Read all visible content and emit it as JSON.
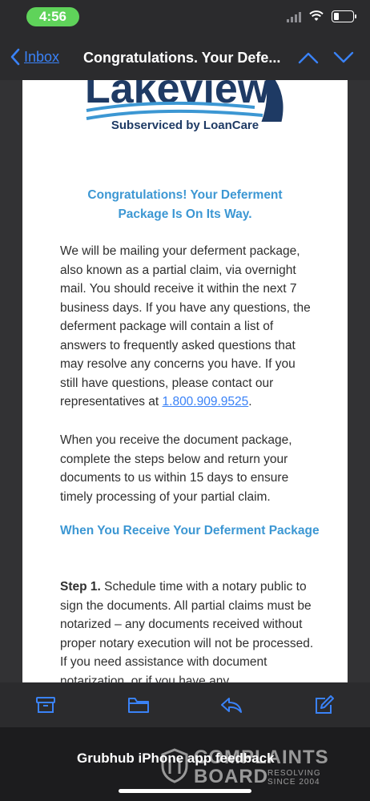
{
  "status_bar": {
    "time": "4:56"
  },
  "nav": {
    "back_label": "Inbox",
    "subject": "Congratulations. Your Defe..."
  },
  "email": {
    "logo_text": "Lakeview",
    "logo_subtitle": "Subserviced by LoanCare",
    "heading_line1": "Congratulations! Your Deferment",
    "heading_line2": "Package Is On Its Way.",
    "para1_text": "We will be mailing your deferment package, also known as a partial claim, via overnight mail. You should receive it within the next 7 business days. If you have any questions, the deferment package will contain a list of answers to frequently asked questions that may resolve any concerns you have. If you still have questions, please contact our representatives at ",
    "phone": "1.800.909.9525",
    "para1_end": ".",
    "para2_text": "When you receive the document package, complete the steps below and return your documents to us within 15 days to ensure timely processing of your partial claim.",
    "subheading": "When You Receive Your Deferment Package",
    "step1_label": "Step 1.",
    "step1_text": " Schedule time with a notary public to sign the documents. All partial claims must be notarized – any documents received without proper notary execution will not be processed. If you need assistance with document notarization, or if you have any"
  },
  "toolbar": {
    "icons": [
      "archive-icon",
      "folder-icon",
      "reply-icon",
      "compose-icon"
    ]
  },
  "overlay": {
    "caption": "Grubhub iPhone app feedback"
  },
  "watermark": {
    "line1": "COMPLAINTS",
    "line2": "BOARD",
    "side1": "RESOLVING",
    "side2": "SINCE 2004"
  },
  "colors": {
    "accent_blue": "#3a82f7",
    "heading_blue": "#3c97d3",
    "logo_navy": "#1e3a64",
    "time_pill_green": "#5fd35a"
  }
}
